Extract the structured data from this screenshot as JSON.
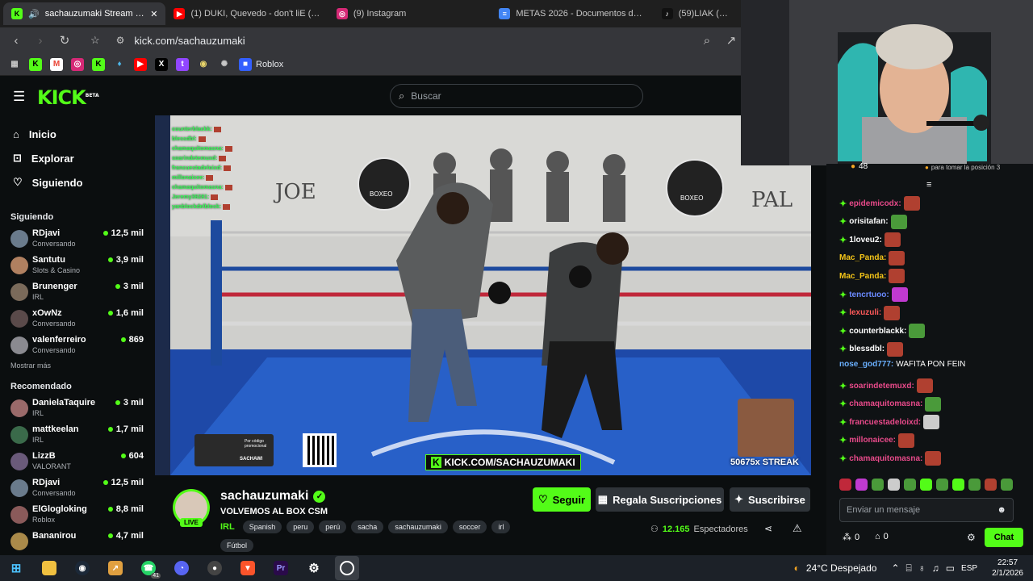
{
  "browser": {
    "tabs": [
      {
        "title": "sachauzumaki Stream - Watc",
        "icon": "kick-icon",
        "color": "#53fc18",
        "active": true
      },
      {
        "title": "(1) DUKI, Quevedo - don't liE (Video",
        "icon": "youtube-icon",
        "color": "#ff0000",
        "active": false
      },
      {
        "title": "(9) Instagram",
        "icon": "instagram-icon",
        "color": "#d62976",
        "active": false
      },
      {
        "title": "METAS 2026 - Documentos de Goog",
        "icon": "docs-icon",
        "color": "#4285f4",
        "active": false
      },
      {
        "title": "(59)LIAK (@liak",
        "icon": "tiktok-icon",
        "color": "#111111",
        "active": false
      }
    ],
    "url": "kick.com/sachauzumaki",
    "bookmark_label": "Roblox"
  },
  "kick": {
    "logo": "KICK",
    "logo_beta": "BETA",
    "search_placeholder": "Buscar",
    "nav": [
      {
        "label": "Inicio",
        "icon": "home-icon"
      },
      {
        "label": "Explorar",
        "icon": "compass-icon"
      },
      {
        "label": "Siguiendo",
        "icon": "heart-icon"
      }
    ],
    "following_title": "Siguiendo",
    "following": [
      {
        "name": "RDjavi",
        "category": "Conversando",
        "viewers": "12,5 mil",
        "color": "#6a7b8c"
      },
      {
        "name": "Santutu",
        "category": "Slots & Casino",
        "viewers": "3,9 mil",
        "color": "#b08060"
      },
      {
        "name": "Brunenger",
        "category": "IRL",
        "viewers": "3 mil",
        "color": "#7a6a5a"
      },
      {
        "name": "xOwNz",
        "category": "Conversando",
        "viewers": "1,6 mil",
        "color": "#5a4a4a"
      },
      {
        "name": "valenferreiro",
        "category": "Conversando",
        "viewers": "869",
        "color": "#8a8a90"
      }
    ],
    "show_more": "Mostrar más",
    "recommended_title": "Recomendado",
    "recommended": [
      {
        "name": "DanielaTaquire",
        "category": "IRL",
        "viewers": "3 mil",
        "color": "#9a6a6a"
      },
      {
        "name": "mattkeelan",
        "category": "IRL",
        "viewers": "1,7 mil",
        "color": "#3a6a4a"
      },
      {
        "name": "LizzB",
        "category": "VALORANT",
        "viewers": "604",
        "color": "#6a5a7a"
      },
      {
        "name": "RDjavi",
        "category": "Conversando",
        "viewers": "12,5 mil",
        "color": "#6a7b8c"
      },
      {
        "name": "ElGlogloking",
        "category": "Roblox",
        "viewers": "8,8 mil",
        "color": "#8a5a5a"
      },
      {
        "name": "Bananirou",
        "category": "",
        "viewers": "4,7 mil",
        "color": "#aa8a4a"
      }
    ]
  },
  "video": {
    "overlay_url": "KICK.COM/SACHAUZUMAKI",
    "streak": "50675x STREAK",
    "wall_text_left": "JOE",
    "wall_text_right": "PAL",
    "logo_text": "BOXEO",
    "promo_text": "Por código promocional",
    "promo_name": "SACHAWI",
    "overlay_chat": [
      "counterblackk:",
      "blessdbl:",
      "chamaquitomasna:",
      "soarindetemuxd:",
      "francuestadeloixd:",
      "millonaicee:",
      "chamaquitomasna:",
      "Jeremy36281:",
      "yanblockdelblock:"
    ]
  },
  "stream": {
    "channel": "sachauzumaki",
    "title": "VOLVEMOS AL BOX CSM",
    "live_badge": "LIVE",
    "category": "IRL",
    "tags": [
      "Spanish",
      "peru",
      "perú",
      "sacha",
      "sachauzumaki",
      "soccer",
      "irl"
    ],
    "tag2": "Fútbol",
    "follow_label": "Seguir",
    "gift_label": "Regala Suscripciones",
    "subscribe_label": "Suscribirse",
    "viewers": "12.165",
    "viewers_label": "Espectadores"
  },
  "chat": {
    "top_count": "48",
    "top_hint": "para tomar la posición 3",
    "messages": [
      {
        "user": "epidemicodx:",
        "color": "#e84a8a",
        "text": "",
        "emote": "#b04030"
      },
      {
        "user": "orisitafan:",
        "color": "#ffffff",
        "text": "",
        "emote": "#4a9a3a"
      },
      {
        "user": "1loveu2:",
        "color": "#ffffff",
        "text": "",
        "emote": "#b04030"
      },
      {
        "user": "Mac_Panda:",
        "color": "#f5c518",
        "text": "",
        "emote": "#b04030",
        "plain": true
      },
      {
        "user": "Mac_Panda:",
        "color": "#f5c518",
        "text": "",
        "emote": "#b04030",
        "plain": true
      },
      {
        "user": "tencrtuoo:",
        "color": "#6a8aff",
        "text": "",
        "emote": "#c03ad0"
      },
      {
        "user": "lexuzuli:",
        "color": "#ff5a5a",
        "text": "",
        "emote": "#b04030"
      },
      {
        "user": "counterblackk:",
        "color": "#ffffff",
        "text": "",
        "emote": "#4a9a3a"
      },
      {
        "user": "blessdbl:",
        "color": "#ffffff",
        "text": "",
        "emote": "#b04030"
      },
      {
        "user": "nose_god777:",
        "color": "#6ab0ff",
        "text": " WAFITA PON FEIN",
        "emote": "",
        "plain": true
      },
      {
        "user": "soarindetemuxd:",
        "color": "#e84a8a",
        "text": "",
        "emote": "#b04030"
      },
      {
        "user": "chamaquitomasna:",
        "color": "#e84a8a",
        "text": "",
        "emote": "#4a9a3a"
      },
      {
        "user": "francuestadeloixd:",
        "color": "#e84a8a",
        "text": "",
        "emote": "#cccccc"
      },
      {
        "user": "millonaicee:",
        "color": "#e84a8a",
        "text": "",
        "emote": "#b04030"
      },
      {
        "user": "chamaquitomasna:",
        "color": "#e84a8a",
        "text": "",
        "emote": "#b04030"
      }
    ],
    "input_placeholder": "Enviar un mensaje",
    "points_a": "0",
    "points_b": "0",
    "send_label": "Chat"
  },
  "taskbar": {
    "weather": "24°C  Despejado",
    "lang": "ESP",
    "time": "22:57",
    "date": "2/1/2026",
    "badge": "41"
  }
}
